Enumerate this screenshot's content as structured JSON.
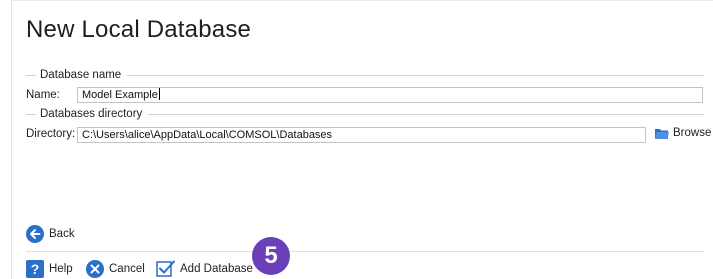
{
  "page": {
    "title": "New Local Database"
  },
  "database_name": {
    "section_label": "Database name",
    "name_label": "Name:",
    "name_value": "Model Example"
  },
  "databases_directory": {
    "section_label": "Databases directory",
    "directory_label": "Directory:",
    "directory_value": "C:\\Users\\alice\\AppData\\Local\\COMSOL\\Databases",
    "browse_label": "Browse"
  },
  "navigation": {
    "back_label": "Back"
  },
  "footer": {
    "help_label": "Help",
    "cancel_label": "Cancel",
    "add_label": "Add Database"
  },
  "annotation": {
    "step_number": "5"
  },
  "colors": {
    "accent_blue": "#2a6fc9",
    "step_badge": "#6a3fb8"
  }
}
